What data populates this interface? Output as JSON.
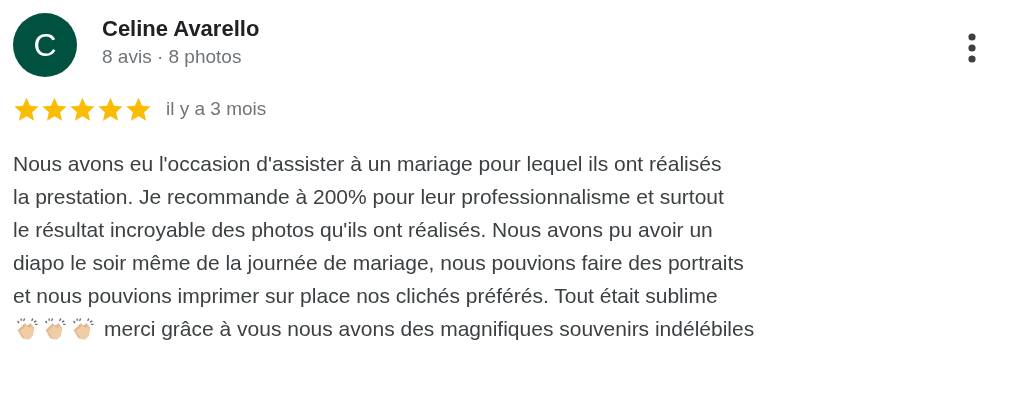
{
  "review": {
    "avatar_initial": "C",
    "author": "Celine Avarello",
    "author_meta": "8 avis · 8 photos",
    "stars": 5,
    "date": "il y a 3 mois",
    "text_lines": [
      "Nous avons eu l'occasion d'assister à un mariage pour lequel ils ont réalisés",
      "la prestation. Je recommande à 200% pour leur professionnalisme et surtout",
      "le résultat incroyable des photos qu'ils ont réalisés. Nous avons pu avoir un",
      "diapo le soir même de la journée de mariage, nous pouvions faire des portraits",
      "et nous pouvions imprimer sur place nos clichés préférés. Tout était sublime",
      "merci grâce à vous nous avons des magnifiques souvenirs indélébiles"
    ]
  }
}
